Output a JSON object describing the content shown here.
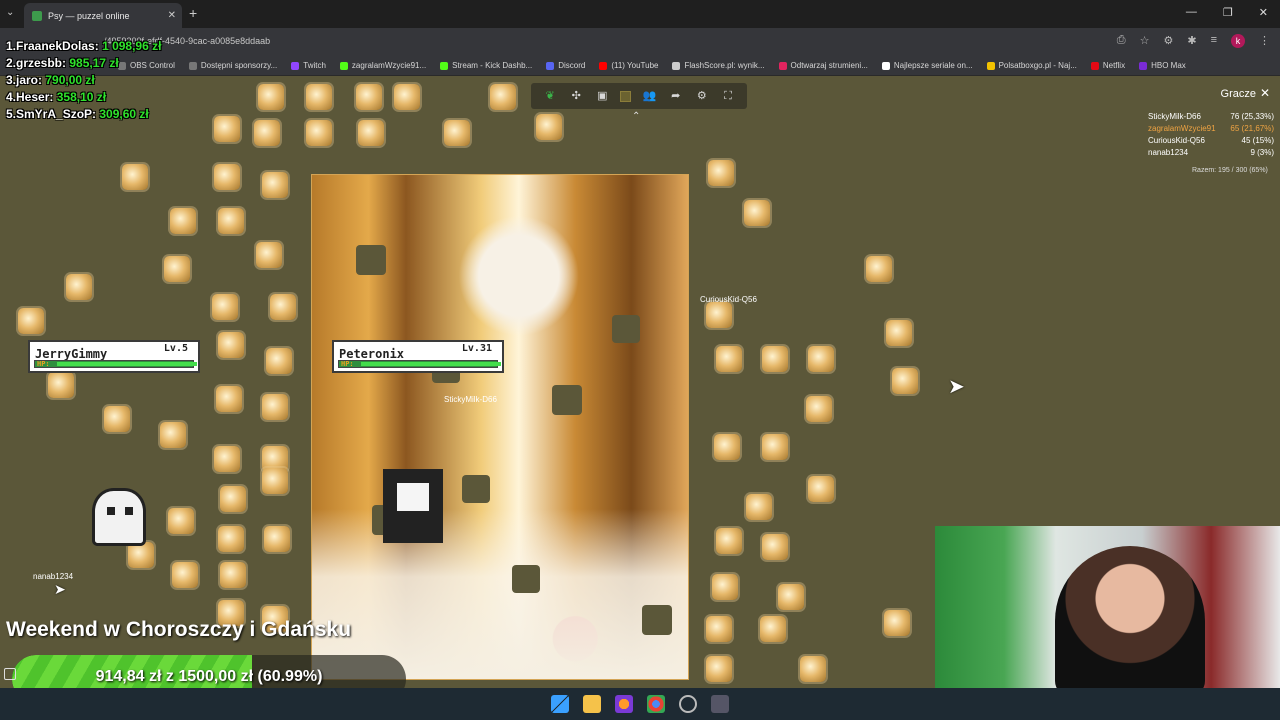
{
  "browser": {
    "tab_title": "Psy — puzzel online",
    "url": "...#/4959300f-efdf-4540-9cac-a0085e8ddaab",
    "url_display": "/4959300f-efdf-4540-9cac-a0085e8ddaab",
    "bookmarks": [
      {
        "label": "OBS Control",
        "color": "#777777"
      },
      {
        "label": "Dostępni sponsorzy...",
        "color": "#777777"
      },
      {
        "label": "Twitch",
        "color": "#9146ff"
      },
      {
        "label": "zagralamWzycie91...",
        "color": "#53fc18"
      },
      {
        "label": "Stream - Kick Dashb...",
        "color": "#53fc18"
      },
      {
        "label": "Discord",
        "color": "#5865f2"
      },
      {
        "label": "(11) YouTube",
        "color": "#ff0000"
      },
      {
        "label": "FlashScore.pl: wynik...",
        "color": "#cccccc"
      },
      {
        "label": "Odtwarzaj strumieni...",
        "color": "#e2245f"
      },
      {
        "label": "Najlepsze seriale on...",
        "color": "#ffffff"
      },
      {
        "label": "Polsatboxgo.pl - Naj...",
        "color": "#f2c200"
      },
      {
        "label": "Netflix",
        "color": "#e50914"
      },
      {
        "label": "HBO Max",
        "color": "#7a2bd6"
      }
    ],
    "profile_initial": "k"
  },
  "leaderboard": [
    {
      "rank_name": "1.FraanekDolas:",
      "amount": "1 098,96 zł"
    },
    {
      "rank_name": "2.grzesbb:",
      "amount": "985,17 zł"
    },
    {
      "rank_name": "3.jaro:",
      "amount": "790,00 zł"
    },
    {
      "rank_name": "4.Heser:",
      "amount": "358,10 zł"
    },
    {
      "rank_name": "5.SmYrA_SzoP:",
      "amount": "309,60 zł"
    }
  ],
  "players_panel": {
    "title": "Gracze",
    "close": "✕",
    "rows": [
      {
        "name": "StickyMilk-D66",
        "score": "76 (25,33%)"
      },
      {
        "name": "zagralamWzycie91",
        "score": "65 (21,67%)"
      },
      {
        "name": "CuriousKid-Q56",
        "score": "45 (15%)"
      },
      {
        "name": "nanab1234",
        "score": "9 (3%)"
      }
    ],
    "total": "Razem: 195 / 300 (65%)"
  },
  "hp_cards": [
    {
      "name": "JerryGimmy",
      "level": "Lv.5",
      "hp_label": "HP:",
      "hp_fraction": 1.0
    },
    {
      "name": "Peteronix",
      "level": "Lv.31",
      "hp_label": "HP:",
      "hp_fraction": 1.0
    }
  ],
  "cursors": {
    "curious": "CuriousKid-Q56",
    "sticky": "StickyMilk-D66",
    "nanab": "nanab1234"
  },
  "goal": {
    "title": "Weekend w Choroszczy i Gdańsku",
    "progress_text": "914,84 zł  z  1500,00 zł  (60.99%)",
    "fraction": 0.6099
  },
  "toolbar_icons": [
    "leaf-icon",
    "puzzle-icon",
    "image-icon",
    "square-icon",
    "players-icon",
    "share-icon",
    "gear-icon",
    "fullscreen-icon"
  ]
}
